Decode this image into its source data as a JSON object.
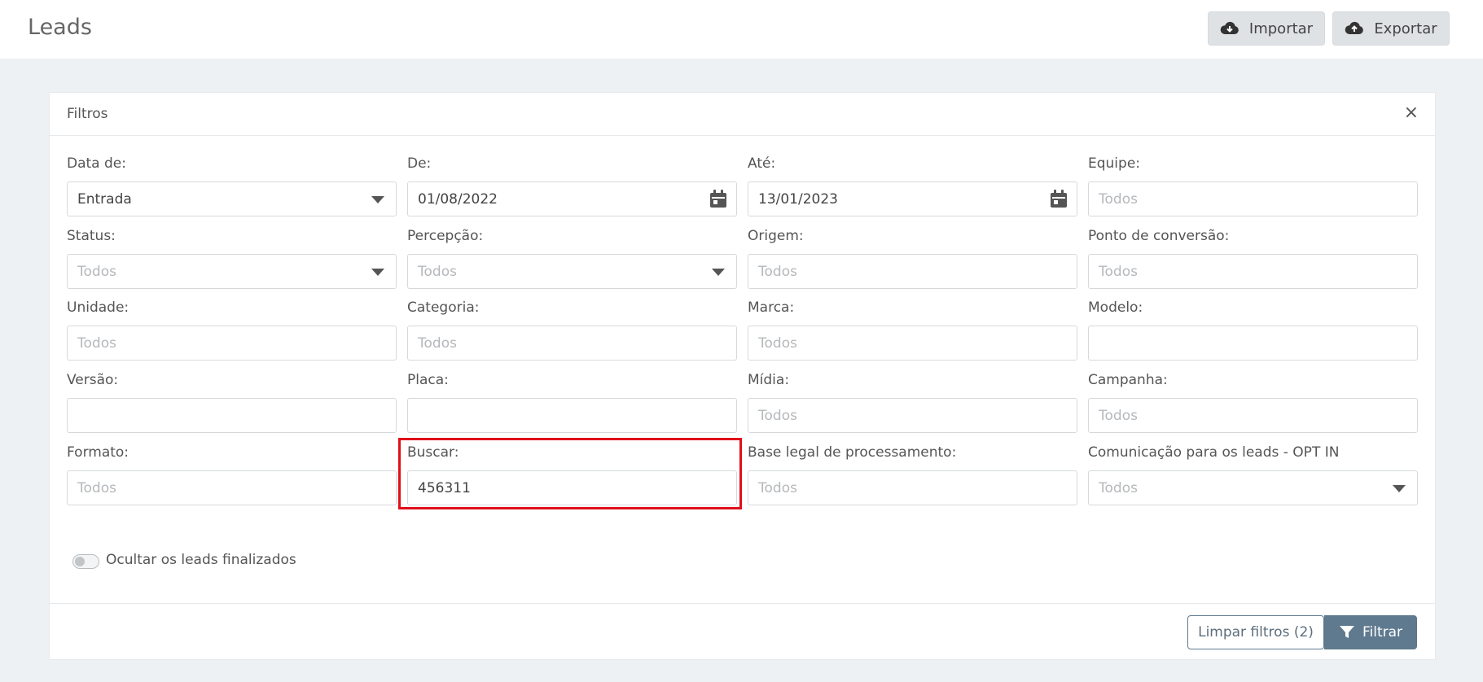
{
  "header": {
    "title": "Leads",
    "import_label": "Importar",
    "export_label": "Exportar",
    "import_icon": "cloud-download-icon",
    "export_icon": "cloud-upload-icon"
  },
  "filters": {
    "title": "Filtros",
    "close_label": "×",
    "fields": {
      "data_de": {
        "label": "Data de:",
        "value": "Entrada"
      },
      "de": {
        "label": "De:",
        "value": "01/08/2022"
      },
      "ate": {
        "label": "Até:",
        "value": "13/01/2023"
      },
      "equipe": {
        "label": "Equipe:",
        "placeholder": "Todos"
      },
      "status": {
        "label": "Status:",
        "placeholder": "Todos"
      },
      "percepcao": {
        "label": "Percepção:",
        "placeholder": "Todos"
      },
      "origem": {
        "label": "Origem:",
        "placeholder": "Todos"
      },
      "ponto_conversao": {
        "label": "Ponto de conversão:",
        "placeholder": "Todos"
      },
      "unidade": {
        "label": "Unidade:",
        "placeholder": "Todos"
      },
      "categoria": {
        "label": "Categoria:",
        "placeholder": "Todos"
      },
      "marca": {
        "label": "Marca:",
        "placeholder": "Todos"
      },
      "modelo": {
        "label": "Modelo:",
        "value": ""
      },
      "versao": {
        "label": "Versão:",
        "value": ""
      },
      "placa": {
        "label": "Placa:",
        "value": ""
      },
      "midia": {
        "label": "Mídia:",
        "placeholder": "Todos"
      },
      "campanha": {
        "label": "Campanha:",
        "placeholder": "Todos"
      },
      "formato": {
        "label": "Formato:",
        "placeholder": "Todos"
      },
      "buscar": {
        "label": "Buscar:",
        "value": "456311"
      },
      "base_legal": {
        "label": "Base legal de processamento:",
        "placeholder": "Todos"
      },
      "comunicacao": {
        "label": "Comunicação para os leads - OPT IN",
        "placeholder": "Todos"
      }
    },
    "hide_finished_label": "Ocultar os leads finalizados",
    "hide_finished_on": false,
    "clear_label": "Limpar filtros (2)",
    "filter_label": "Filtrar",
    "highlight_color": "#e0101a",
    "accent_color": "#5f7a8f"
  }
}
